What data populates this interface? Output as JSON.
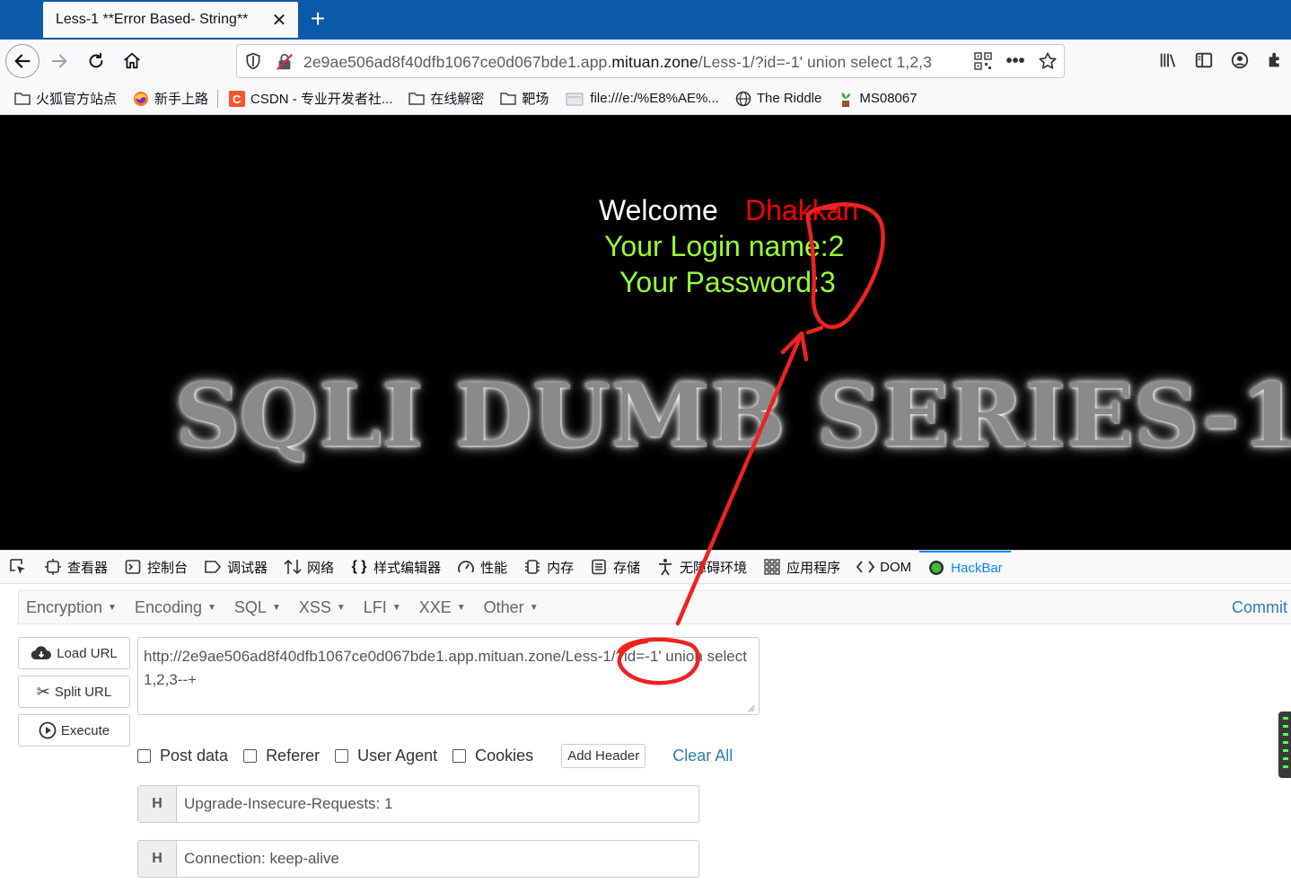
{
  "browser": {
    "tab_title": "Less-1 **Error Based- String**",
    "url_prefix": "2e9ae506ad8f40dfb1067ce0d067bde1.app.",
    "url_host": "mituan.zone",
    "url_path": "/Less-1/?id=-1' union select 1,2,3"
  },
  "bookmarks": [
    {
      "label": "火狐官方站点",
      "icon": "folder-icon"
    },
    {
      "label": "新手上路",
      "icon": "firefox-icon"
    },
    {
      "label": "CSDN - 专业开发者社...",
      "icon": "csdn-icon"
    },
    {
      "label": "在线解密",
      "icon": "folder-icon"
    },
    {
      "label": "靶场",
      "icon": "folder-icon"
    },
    {
      "label": "file:///e:/%E8%AE%...",
      "icon": "file-icon"
    },
    {
      "label": "The Riddle",
      "icon": "globe-icon"
    },
    {
      "label": "MS08067",
      "icon": "plant-icon"
    }
  ],
  "page": {
    "welcome": "Welcome",
    "name": "Dhakkan",
    "login_name": "Your Login name:2",
    "password": "Your Password:3",
    "banner": "SQLI DUMB SERIES-1",
    "colors": {
      "welcome": "#ffffff",
      "name": "#ff0000",
      "result": "#99ff33"
    }
  },
  "devtools": {
    "tabs": [
      {
        "label": "查看器",
        "icon": "inspector-icon"
      },
      {
        "label": "控制台",
        "icon": "console-icon"
      },
      {
        "label": "调试器",
        "icon": "debugger-icon"
      },
      {
        "label": "网络",
        "icon": "network-icon"
      },
      {
        "label": "样式编辑器",
        "icon": "style-editor-icon"
      },
      {
        "label": "性能",
        "icon": "performance-icon"
      },
      {
        "label": "内存",
        "icon": "memory-icon"
      },
      {
        "label": "存储",
        "icon": "storage-icon"
      },
      {
        "label": "无障碍环境",
        "icon": "accessibility-icon"
      },
      {
        "label": "应用程序",
        "icon": "application-icon"
      },
      {
        "label": "DOM",
        "icon": "dom-icon"
      },
      {
        "label": "HackBar",
        "icon": "hackbar-icon"
      }
    ],
    "active_tab": "HackBar"
  },
  "hackbar": {
    "menu": [
      "Encryption",
      "Encoding",
      "SQL",
      "XSS",
      "LFI",
      "XXE",
      "Other"
    ],
    "commit": "Commit",
    "load_url": "Load URL",
    "split_url": "Split URL",
    "execute": "Execute",
    "url_value": "http://2e9ae506ad8f40dfb1067ce0d067bde1.app.mituan.zone/Less-1/?id=-1' union select 1,2,3--+",
    "checkboxes": [
      "Post data",
      "Referer",
      "User Agent",
      "Cookies"
    ],
    "add_header": "Add Header",
    "clear_all": "Clear All",
    "headers": [
      {
        "key": "H",
        "value": "Upgrade-Insecure-Requests: 1"
      },
      {
        "key": "H",
        "value": "Connection: keep-alive"
      }
    ]
  },
  "annotation": {
    "color": "#ee2222"
  }
}
